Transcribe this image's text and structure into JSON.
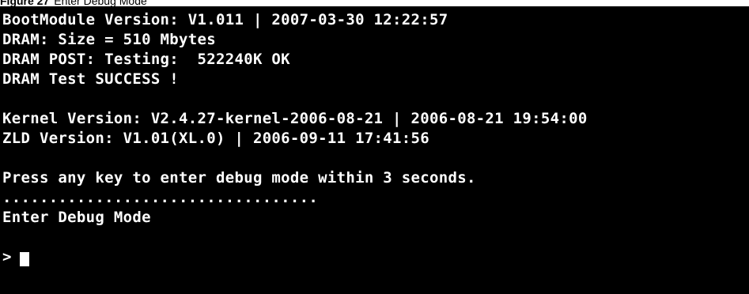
{
  "caption": {
    "label": "Figure 27",
    "title": "Enter Debug Mode"
  },
  "terminal": {
    "lines": [
      "BootModule Version: V1.011 | 2007-03-30 12:22:57",
      "DRAM: Size = 510 Mbytes",
      "DRAM POST: Testing:  522240K OK",
      "DRAM Test SUCCESS !",
      "",
      "Kernel Version: V2.4.27-kernel-2006-08-21 | 2006-08-21 19:54:00",
      "ZLD Version: V1.01(XL.0) | 2006-09-11 17:41:56",
      "",
      "Press any key to enter debug mode within 3 seconds.",
      "..................................",
      "Enter Debug Mode",
      ""
    ],
    "prompt": ">"
  }
}
